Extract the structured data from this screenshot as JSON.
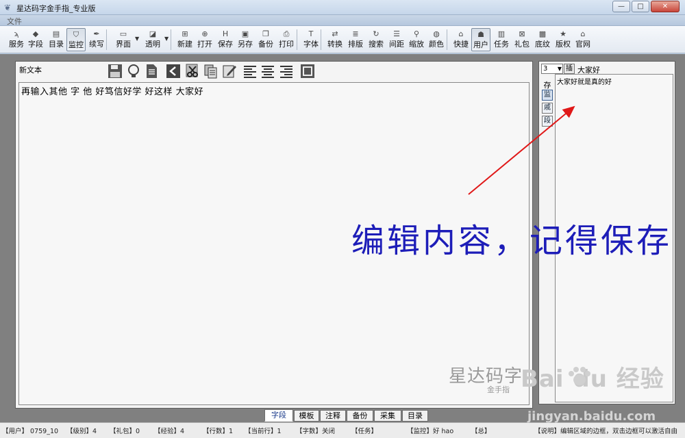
{
  "window": {
    "title": "星达码字金手指_专业版",
    "controls": {
      "minimize": "—",
      "maximize": "□",
      "close": "✕"
    }
  },
  "menu": {
    "file": "文件"
  },
  "toolbar": {
    "items": [
      {
        "label": "服务",
        "icon": "rss-icon",
        "glyph": "ϡ"
      },
      {
        "label": "字段",
        "icon": "diamond-icon",
        "glyph": "◆"
      },
      {
        "label": "目录",
        "icon": "list-icon",
        "glyph": "▤"
      },
      {
        "label": "监控",
        "icon": "shield-icon",
        "glyph": "⛉",
        "pressed": true
      },
      {
        "label": "续写",
        "icon": "pen-icon",
        "glyph": "✒"
      },
      {
        "label": "界面",
        "icon": "window-icon",
        "glyph": "▭",
        "dropdown": true
      },
      {
        "label": "透明",
        "icon": "image-icon",
        "glyph": "◪",
        "dropdown": true
      },
      {
        "label": "新建",
        "icon": "new-icon",
        "glyph": "⊞"
      },
      {
        "label": "打开",
        "icon": "open-icon",
        "glyph": "⊕"
      },
      {
        "label": "保存",
        "icon": "save-icon",
        "glyph": "H"
      },
      {
        "label": "另存",
        "icon": "save-as-icon",
        "glyph": "▣"
      },
      {
        "label": "备份",
        "icon": "backup-icon",
        "glyph": "❐"
      },
      {
        "label": "打印",
        "icon": "print-icon",
        "glyph": "⎙"
      },
      {
        "label": "字体",
        "icon": "font-icon",
        "glyph": "T"
      },
      {
        "label": "转换",
        "icon": "convert-icon",
        "glyph": "⇄"
      },
      {
        "label": "排版",
        "icon": "layout-icon",
        "glyph": "≣"
      },
      {
        "label": "搜索",
        "icon": "refresh-icon",
        "glyph": "↻"
      },
      {
        "label": "间距",
        "icon": "spacing-icon",
        "glyph": "☰"
      },
      {
        "label": "缩放",
        "icon": "zoom-icon",
        "glyph": "⚲"
      },
      {
        "label": "颜色",
        "icon": "color-icon",
        "glyph": "◍"
      },
      {
        "label": "快捷",
        "icon": "home-icon",
        "glyph": "⌂"
      },
      {
        "label": "用户",
        "icon": "user-icon",
        "glyph": "☗",
        "pressed": true
      },
      {
        "label": "任务",
        "icon": "task-icon",
        "glyph": "▥"
      },
      {
        "label": "礼包",
        "icon": "gift-icon",
        "glyph": "⊠"
      },
      {
        "label": "底纹",
        "icon": "texture-icon",
        "glyph": "▩"
      },
      {
        "label": "版权",
        "icon": "star-icon",
        "glyph": "★"
      },
      {
        "label": "官网",
        "icon": "website-icon",
        "glyph": "⌂"
      }
    ]
  },
  "editor": {
    "doc_name": "新文本",
    "content": "再输入其他 字 他 好笃信好学 好这样 大家好",
    "watermark_main": "星达码字",
    "watermark_sub": "金手指"
  },
  "side": {
    "level": "3",
    "insert_label": "插",
    "greeting": "大家好",
    "store_label": "存",
    "buttons": [
      "监",
      "戚",
      "段"
    ],
    "text": "大家好就是真的好"
  },
  "annotation": {
    "text": "编辑内容，记得保存"
  },
  "watermarks": {
    "baidu": "Bai du 经验",
    "baidu_url": "jingyan.baidu.com"
  },
  "tabs": [
    {
      "label": "字段",
      "active": true
    },
    {
      "label": "模板"
    },
    {
      "label": "注释"
    },
    {
      "label": "备份"
    },
    {
      "label": "采集"
    },
    {
      "label": "目录"
    }
  ],
  "status": {
    "user": "【用户】 0759_10",
    "level": "【级别】4",
    "gift": "【礼包】0",
    "exp": "【经验】4",
    "lines": "【行数】1",
    "current_line": "【当前行】1",
    "char_count": "【字数】关闭",
    "task": "【任务】",
    "monitor": "【监控】好 hao",
    "total": "【总】",
    "help": "【说明】编辑区域的边框，双击边框可以激活自由"
  }
}
